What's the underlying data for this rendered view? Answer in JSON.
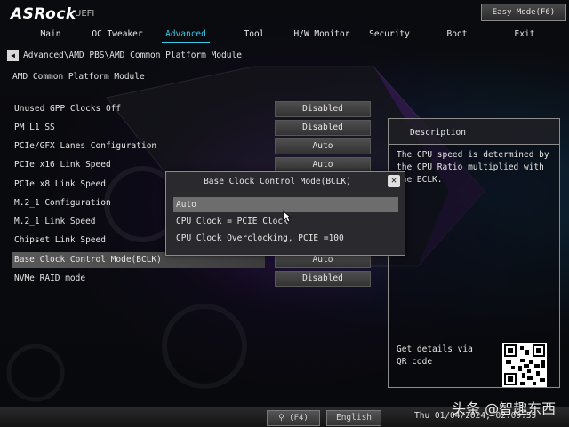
{
  "header": {
    "logo": "ASRock",
    "uefi": "UEFI",
    "easy_mode": "Easy Mode(F6)"
  },
  "menu": {
    "tabs": [
      {
        "label": "Main"
      },
      {
        "label": "OC Tweaker"
      },
      {
        "label": "Advanced"
      },
      {
        "label": "Tool"
      },
      {
        "label": "H/W Monitor"
      },
      {
        "label": "Security"
      },
      {
        "label": "Boot"
      },
      {
        "label": "Exit"
      }
    ],
    "active": "Advanced"
  },
  "breadcrumb": "Advanced\\AMD PBS\\AMD Common Platform Module",
  "section_title": "AMD Common Platform Module",
  "options": [
    {
      "label": "Unused GPP Clocks Off",
      "value": "Disabled"
    },
    {
      "label": "PM L1 SS",
      "value": "Disabled"
    },
    {
      "label": "PCIe/GFX Lanes Configuration",
      "value": "Auto"
    },
    {
      "label": "PCIe x16 Link Speed",
      "value": "Auto"
    },
    {
      "label": "PCIe x8 Link Speed",
      "value": ""
    },
    {
      "label": "M.2_1 Configuration",
      "value": ""
    },
    {
      "label": "M.2_1 Link Speed",
      "value": ""
    },
    {
      "label": "Chipset Link Speed",
      "value": ""
    },
    {
      "label": "Base Clock Control Mode(BCLK)",
      "value": "Auto"
    },
    {
      "label": "NVMe RAID mode",
      "value": "Disabled"
    }
  ],
  "description": {
    "title": "Description",
    "text": "The CPU speed is determined by the CPU Ratio multiplied with the BCLK.",
    "qr_label": "Get details via QR code"
  },
  "modal": {
    "title": "Base Clock Control Mode(BCLK)",
    "close_icon": "close-icon",
    "options": [
      "Auto",
      "CPU Clock = PCIE Clock",
      "CPU Clock Overclocking, PCIE =100"
    ],
    "selected": "Auto"
  },
  "footer": {
    "search_label": "(F4)",
    "language": "English",
    "datetime": "Thu 01/04/2024, 02:09:55"
  },
  "watermark": "头条 @智趣东西",
  "colors": {
    "accent": "#37c9e8",
    "selected_row": "#5a5a5a",
    "modal_selected": "#6d6d6d"
  }
}
